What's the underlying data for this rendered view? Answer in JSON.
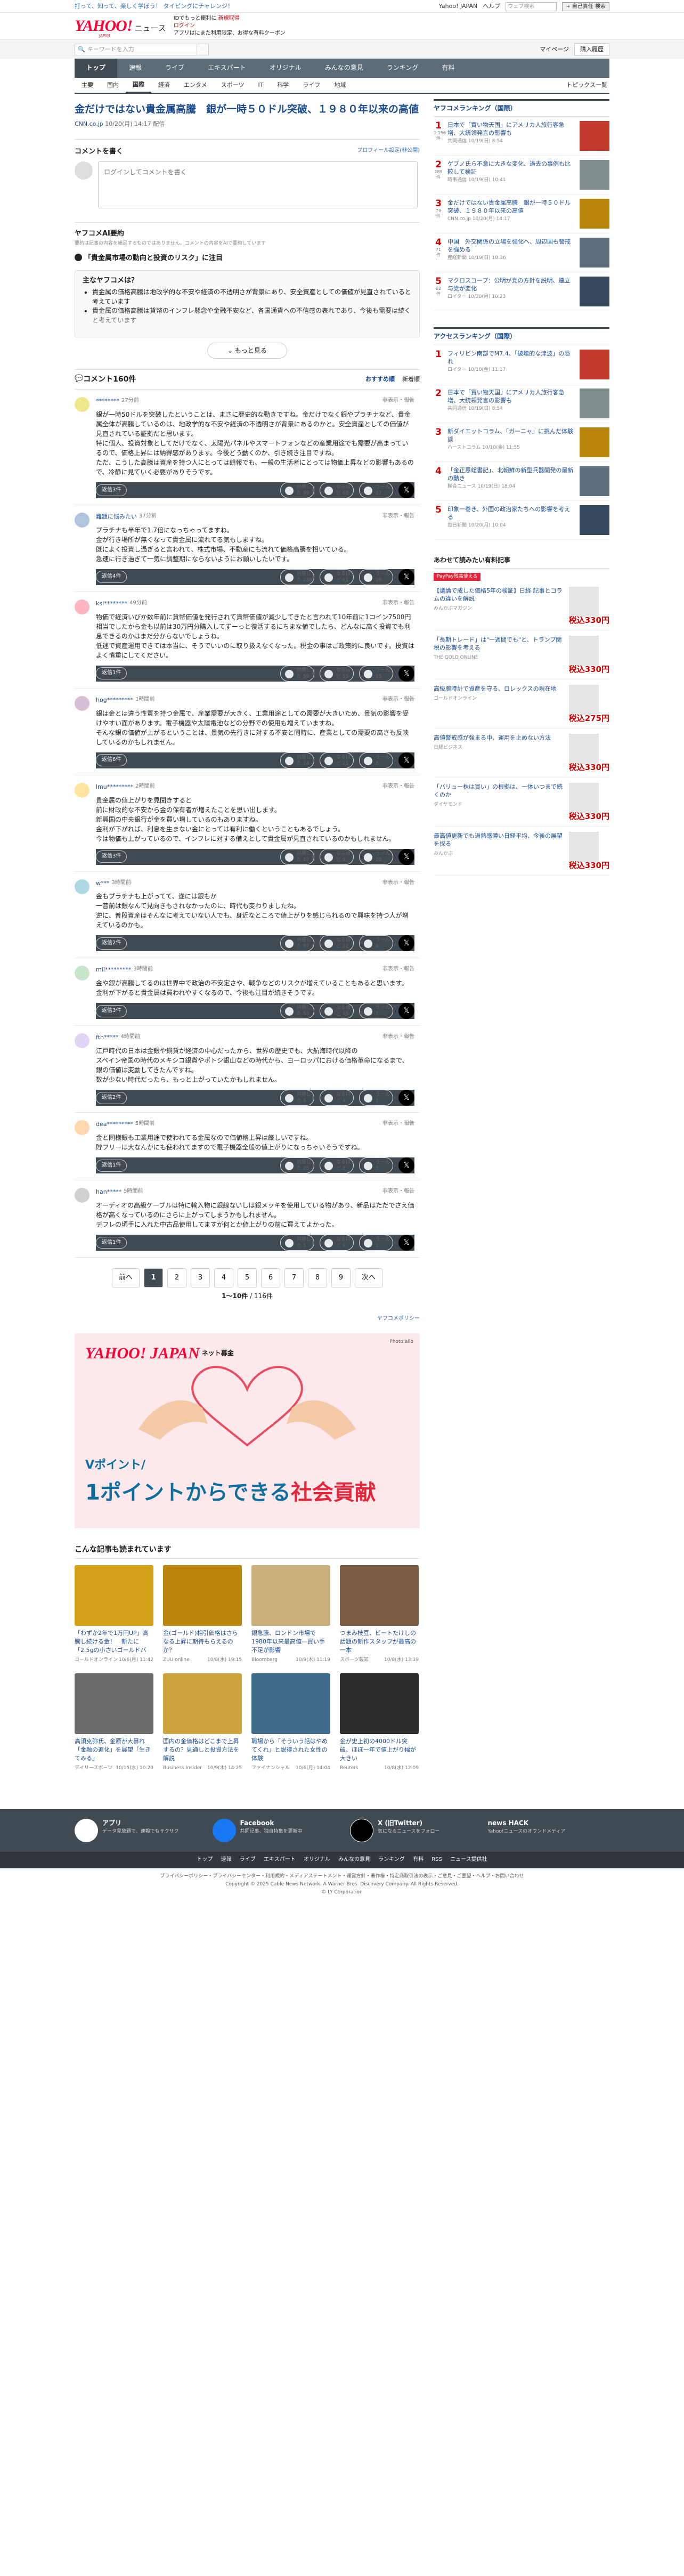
{
  "strip": {
    "promo": "打って、知って、楽しく学ぼう！ タイピングにチャレンジ！",
    "links": [
      "Yahoo! JAPAN",
      "ヘルプ"
    ],
    "search_placeholder": "ウェブ検索",
    "search_btn": "+ 自己責任 検索"
  },
  "header": {
    "logo": "YAHOO!",
    "news": "ニュース",
    "japan": "JAPAN",
    "tag1": "IDでもっと便利に",
    "tag1b": "新規取得",
    "tag2": "ログイン",
    "tag3": "アプリはにまた利用限定、お得な有料クーポン"
  },
  "search": {
    "placeholder": "キーワードを入力",
    "mypage": "マイページ",
    "buy": "購入履歴"
  },
  "gnav": [
    "トップ",
    "速報",
    "ライブ",
    "エキスパート",
    "オリジナル",
    "みんなの意見",
    "ランキング",
    "有料"
  ],
  "snav": [
    "主要",
    "国内",
    "国際",
    "経済",
    "エンタメ",
    "スポーツ",
    "IT",
    "科学",
    "ライフ",
    "地域"
  ],
  "snav_right": "トピックス一覧",
  "article": {
    "title": "金だけではない貴金属高騰　銀が一時５０ドル突破、１９８０年以来の高値",
    "source": "CNN.co.jp",
    "time": "10/20(月) 14:17 配信"
  },
  "write": {
    "title": "コメントを書く",
    "profile": "プロフィール設定(非公開)",
    "placeholder": "ログインしてコメントを書く"
  },
  "ai": {
    "title": "ヤフコメAI要約",
    "note": "要約は記事の内容を補足するものではありません。コメントの内容をAIで要約しています",
    "q": "「貴金属市場の動向と投資のリスク」に注目",
    "sub": "主なヤフコメは？",
    "bullets": [
      "貴金属の価格高騰は地政学的な不安や経済の不透明さが背景にあり、安全資産としての価値が見直されていると考えています",
      "貴金属の価格高騰は貨幣のインフレ懸念や金融不安など、各国通貨への不信感の表れであり、今後も需要は続くと考えています"
    ],
    "more": "もっと見る"
  },
  "clist": {
    "title": "コメント160件",
    "sort1": "おすすめ順",
    "sort2": "新着順"
  },
  "comments": [
    {
      "user": "********",
      "time": "27分前",
      "report": "非表示・報告",
      "text": "銀が一時50ドルを突破したということは、まさに歴史的な動きですね。金だけでなく銀やプラチナなど、貴金属全体が高騰しているのは、地政学的な不安や経済の不透明さが背景にあるのかと。安全資産としての価値が見直されている証拠だと思います。\n特に個人、投資対象としてだけでなく、太陽光パネルやスマートフォンなどの産業用途でも需要が高まっているので、価格上昇には納得感があります。今後どう動くのか、引き続き注目ですね。\nただ、こうした高騰は資産を持つ人にとっては朗報でも、一般の生活者にとっては物価上昇などの影響もあるので、冷静に見ていく必要がありそうです。",
      "rbtn": "返信3件",
      "r1": "共感した 99",
      "r2": "なるほど 68",
      "r3": "うーん 17"
    },
    {
      "user": "難題に悩みたい",
      "time": "37分前",
      "report": "非表示・報告",
      "text": "プラチナも半年で1.7倍になっちゃってますね。\n金が行き場所が無くなって貴金属に流れてる気もしますね。\n既によく投資し過ぎると言われて、株式市場、不動産にも流れて価格高騰を招いている。\n急速に行き過ぎて一気に調整期にならないようにお願いしたいです。",
      "rbtn": "返信4件",
      "r1": "共感した 235",
      "r2": "なるほど 61",
      "r3": "うーん 29"
    },
    {
      "user": "ksi********",
      "time": "49分前",
      "report": "非表示・報告",
      "text": "物価で経済いびか数年前に貨幣価値を発行されて貨幣価値が減少してきたと言われて10年前に1コイン7500円相当でしたから金も以前は30万円分購入してずーっと復活するにちまな値でしたら、どんなに高く投資でも利息できるのかはまだ分からないでしょうね。\n低迷で資産運用できては本当に、そうでいいのに取り扱えなくなった。税金の事はご政策的に良いです。投資はよく慎重にしてください。",
      "rbtn": "返信1件",
      "r1": "共感した 59",
      "r2": "なるほど 55",
      "r3": "うーん 15"
    },
    {
      "user": "hog*********",
      "time": "1時間前",
      "report": "非表示・報告",
      "text": "銀は金とは違う性質を持つ金属で、産業需要が大きく、工業用途としての需要が大きいため、景気の影響を受けやすい面があります。電子機器や太陽電池などの分野での使用も増えていますね。\nそんな銀の価値が上がるということは、景気の先行きに対する不安と同時に、産業としての需要の高さも反映しているのかもしれません。",
      "rbtn": "返信6件",
      "r1": "共感した 14",
      "r2": "なるほど 21",
      "r3": "うーん 8"
    },
    {
      "user": "lmu*********",
      "time": "2時間前",
      "report": "非表示・報告",
      "text": "貴金属の値上がりを見聞きすると\n前に財政的な不安から金の保有者が増えたことを思い出します。\n新興国の中央銀行が金を買い増しているのもありますね。\n金利が下がれば、利息を生まない金にとっては有利に働くということもあるでしょう。\n今は物価も上がっているので、インフレに対する備えとして貴金属が見直されているのかもしれません。",
      "rbtn": "返信3件",
      "r1": "共感した 17",
      "r2": "なるほど 9",
      "r3": "うーん 20"
    },
    {
      "user": "w***",
      "time": "3時間前",
      "report": "非表示・報告",
      "text": "金もプラチナも上がってて、遂には銀もか\n一昔前は銀なんて見向きもされなかったのに、時代も変わりましたね。\n逆に、普段資産はそんなに考えていない人でも、身近なところで値上がりを感じられるので興味を持つ人が増えているのかも。",
      "rbtn": "返信2件",
      "r1": "共感した 87",
      "r2": "なるほど 22",
      "r3": "うーん 4"
    },
    {
      "user": "mil*********",
      "time": "3時間前",
      "report": "非表示・報告",
      "text": "金や銀が高騰してるのは世界中で政治の不安定さや、戦争などのリスクが増えていることもあると思います。\n金利が下がると貴金属は買われやすくなるので、今後も注目が続きそうです。",
      "rbtn": "返信3件",
      "r1": "共感した 53",
      "r2": "なるほど 15",
      "r3": "うーん 7"
    },
    {
      "user": "fth*****",
      "time": "4時間前",
      "report": "非表示・報告",
      "text": "江戸時代の日本は金銀や銅貨が経済の中心だったから、世界の歴史でも、大航海時代以降の\nスペイン帝国の時代のメキシコ銀貨やポトシ銀山などの時代から、ヨーロッパにおける価格革命になるまで、銀の価値は変動してきたんですね。\n数が少ない時代だったら、もっと上がっていたかもしれません。",
      "rbtn": "返信2件",
      "r1": "共感した 8",
      "r2": "なるほど 4",
      "r3": "うーん 1"
    },
    {
      "user": "dea*********",
      "time": "5時間前",
      "report": "非表示・報告",
      "text": "金と同様銀も工業用途で使われてる金属なので価値格上昇は厳しいですね。\n貯フリーは大なんかにも使われてますので電子機器全般の値上がりになっちゃいそうですね。",
      "rbtn": "返信1件",
      "r1": "共感した 25",
      "r2": "なるほど 8",
      "r3": "うーん 3"
    },
    {
      "user": "han*****",
      "time": "5時間前",
      "report": "非表示・報告",
      "text": "オーディオの高級ケーブルは特に輸入物に銀線ないしは銀メッキを使用している物があり、新品はただでさえ価格が高くなっているのにさらに上がってしまうかもしれません。\nデフレの頃手に入れた中古品使用してますが何とか値上がりの前に買えてよかった。",
      "rbtn": "返信1件",
      "r1": "共感した 5",
      "r2": "なるほど 6",
      "r3": "うーん 2"
    }
  ],
  "pager": {
    "prev": "前へ",
    "pages": [
      "1",
      "2",
      "3",
      "4",
      "5",
      "6",
      "7",
      "8",
      "9"
    ],
    "next": "次へ",
    "count": "1〜10件",
    "total": "/ 116件"
  },
  "cpolicy": "ヤフコメポリシー",
  "banner": {
    "logo": "YAHOO! JAPAN",
    "sub": "ネット募金",
    "credit": "Photo:allo",
    "l1": "Vポイント/",
    "l2a": "1ポイントからできる",
    "l2b": "社会貢献"
  },
  "rec": {
    "title": "こんな記事も読まれています",
    "items": [
      {
        "h": "「わずか2年で1万円UP」高騰し続ける金！　新たに「2.5gの小さいゴールドバー」を",
        "s": "ゴールドオンライン",
        "d": "10/6(月) 11:42"
      },
      {
        "h": "金(ゴールド)相引価格はさらなる上昇に期待もらえるのか？",
        "s": "ZUU online",
        "d": "10/8(水) 19:15"
      },
      {
        "h": "銀急騰、ロンドン市場で1980年以来最高値―買い手不足が影響",
        "s": "Bloomberg",
        "d": "10/9(木) 11:19"
      },
      {
        "h": "つまみ枝豆、ビートたけしの話題の新作スタッフが最高の一本",
        "s": "スポーツ報知",
        "d": "10/8(水) 13:39"
      },
      {
        "h": "高須克弥氏、金原が大暴れ「金融の進化」を展望「生きてみる」",
        "s": "デイリースポーツ",
        "d": "10/15(水) 10:20"
      },
      {
        "h": "国内の金価格はどこまで上昇するの？見通しと投資方法を解説",
        "s": "Business Insider",
        "d": "10/9(木) 14:25"
      },
      {
        "h": "職場から「そういう話はやめてくれ」と説得された女性の体験",
        "s": "ファイナンシャル",
        "d": "10/6(月) 14:04"
      },
      {
        "h": "金が史上初の4000ドル突破、ほぼ一年で値上がり幅が大きい",
        "s": "Reuters",
        "d": "10/8(水) 12:09"
      }
    ]
  },
  "side": {
    "rank_title": "ヤフコメランキング（国際）",
    "rank": [
      {
        "r": "1",
        "n": "1,156件",
        "h": "日本で「買い物天国」にアメリカ人旅行客急増、大統領発言の影響も",
        "s": "共同通信 10/19(日) 8:54"
      },
      {
        "r": "2",
        "n": "289件",
        "h": "ゲブノ氏ら不意に大きな変化、過去の事例も比較して検証",
        "s": "時事通信 10/19(日) 10:41"
      },
      {
        "r": "3",
        "n": "79件",
        "h": "金だけではない貴金属高騰　銀が一時５０ドル突破、１９８０年以来の高値",
        "s": "CNN.co.jp 10/20(月) 14:17"
      },
      {
        "r": "4",
        "n": "71件",
        "h": "中国　外交関係の立場を強化へ、周辺国も警戒を強める",
        "s": "産経新聞 10/19(日) 18:36"
      },
      {
        "r": "5",
        "n": "62件",
        "h": "マクロスコープ：公明が党の方針を説明、連立与党が変化",
        "s": "ロイター 10/20(月) 10:23"
      }
    ],
    "access_title": "アクセスランキング（国際）",
    "access": [
      {
        "r": "1",
        "h": "フィリピン南部でM7.4、「破壊的な津波」の恐れ",
        "s": "ロイター 10/10(金) 11:17"
      },
      {
        "r": "2",
        "h": "日本で「買い物天国」にアメリカ人旅行客急増、大統領発言の影響も",
        "s": "共同通信 10/19(日) 8:54"
      },
      {
        "r": "3",
        "h": "新ダイエットコラム、「ガーニャ」に挑んだ体験談",
        "s": "ハーストコラム 10/10(金) 11:55"
      },
      {
        "r": "4",
        "h": "「金正恩総書記」、北朝鮮の新型兵器開発の最新の動き",
        "s": "聯合ニュース 10/19(日) 18:04"
      },
      {
        "r": "5",
        "h": "印象一巻き、外国の政治家たちへの影響を考える",
        "s": "毎日新聞 10/20(月) 10:04"
      }
    ],
    "pro_title": "あわせて読みたい有料記事",
    "pro_tag": "PayPay残高使える",
    "pro": [
      {
        "h": "【議論で成した価格5年の検証】日経 記事とコラムの違いを解説",
        "s": "みんかぶマガジン",
        "p": "税込330円"
      },
      {
        "h": "「長期トレード」は\"一週間でも\"と、トランプ関税の影響を考える",
        "s": "THE GOLD ONLINE",
        "p": "税込330円"
      },
      {
        "h": "高級腕時計で資産を守る、ロレックスの現在地",
        "s": "ゴールドオンライン",
        "p": "税込275円"
      },
      {
        "h": "高値警戒感が強まる中、運用を止めない方法",
        "s": "日経ビジネス",
        "p": "税込330円"
      },
      {
        "h": "「バリュー株は買い」の根拠は、一体いつまで続くのか",
        "s": "ダイヤモンド",
        "p": "税込330円"
      },
      {
        "h": "最高値更新でも過熱感薄い日経平均、今後の展望を探る",
        "s": "みんかぶ",
        "p": "税込330円"
      }
    ]
  },
  "footer": {
    "apps": [
      {
        "n": "アプリ",
        "d": "データ見放題で、速報でもサクサク"
      },
      {
        "n": "Facebook",
        "d": "共同記事、独自特集を更新中"
      },
      {
        "n": "X (旧Twitter)",
        "d": "気になるニュースをフォロー"
      },
      {
        "n": "news HACK",
        "d": "Yahoo!ニュースのオウンドメディア"
      }
    ],
    "nav": [
      "トップ",
      "速報",
      "ライブ",
      "エキスパート",
      "オリジナル",
      "みんなの意見",
      "ランキング",
      "有料",
      "RSS",
      "ニュース提供社"
    ],
    "legal1": "プライバシーポリシー・プライバシーセンター・利用規約・メディアステートメント・運営方針・著作権・特定商取引法の表示・ご意見・ご要望・ヘルプ・お問い合わせ",
    "legal2": "Copyright © 2025 Cable News Network. A Warner Bros. Discovery Company. All Rights Reserved.",
    "legal3": "© LY Corporation"
  },
  "colors": {
    "brand": "#ff0033",
    "nav": "#5c6b75",
    "link": "#1a4b8f"
  }
}
